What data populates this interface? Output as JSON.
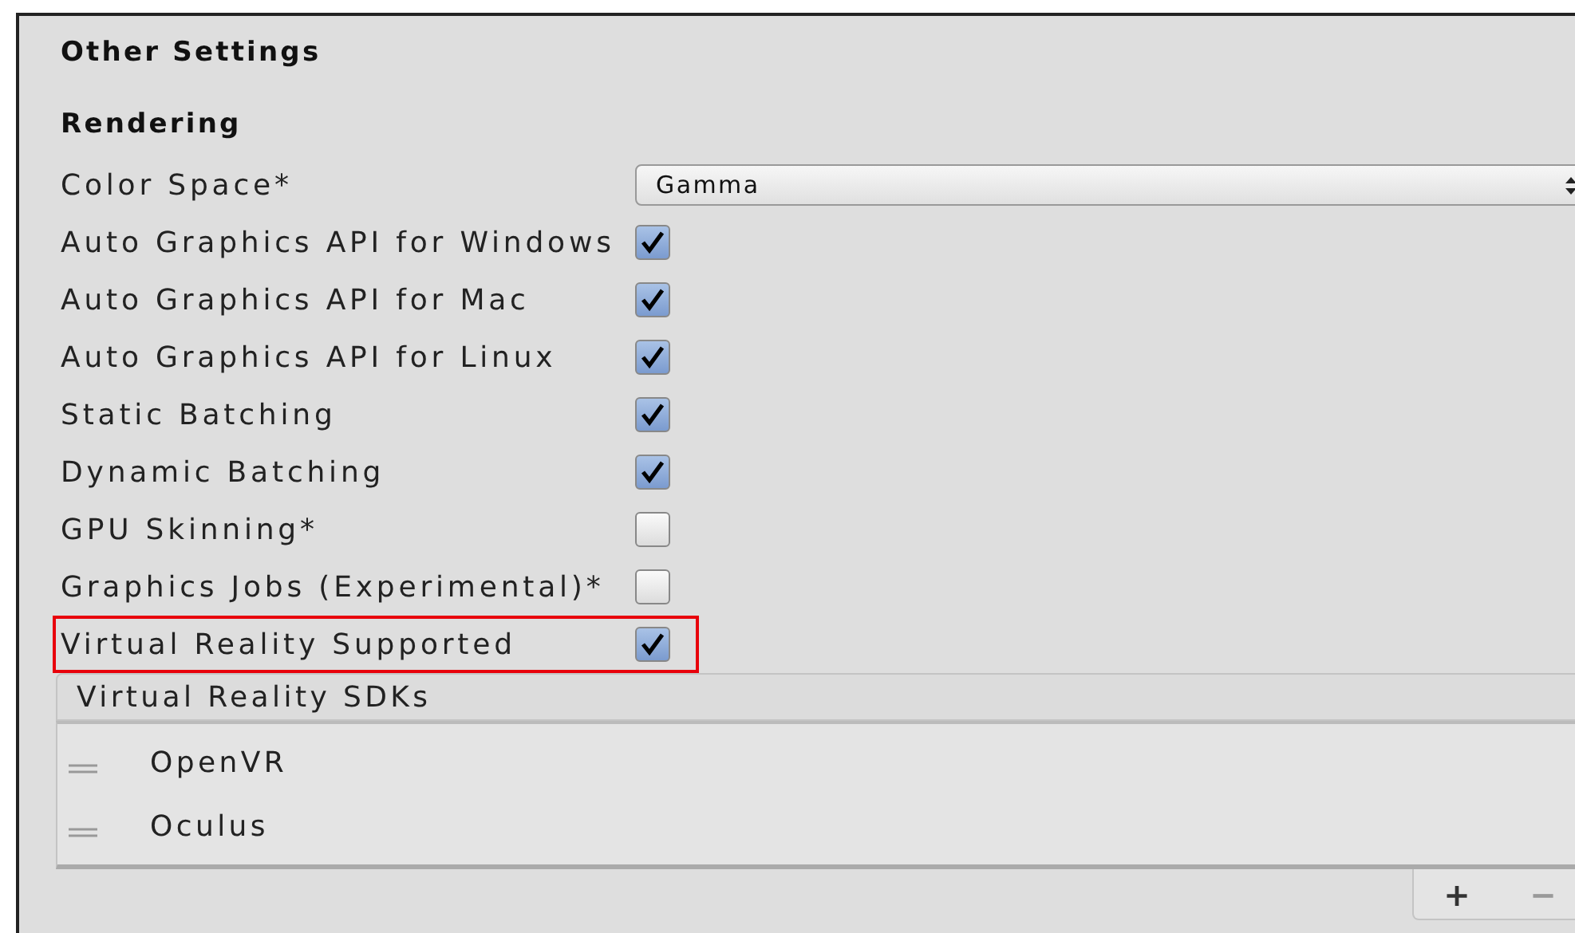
{
  "section_title": "Other Settings",
  "group_title": "Rendering",
  "color_space": {
    "label": "Color Space*",
    "value": "Gamma"
  },
  "settings": [
    {
      "label": "Auto Graphics API for Windows",
      "checked": true,
      "highlighted": false
    },
    {
      "label": "Auto Graphics API for Mac",
      "checked": true,
      "highlighted": false
    },
    {
      "label": "Auto Graphics API for Linux",
      "checked": true,
      "highlighted": false
    },
    {
      "label": "Static Batching",
      "checked": true,
      "highlighted": false
    },
    {
      "label": "Dynamic Batching",
      "checked": true,
      "highlighted": false
    },
    {
      "label": "GPU Skinning*",
      "checked": false,
      "highlighted": false
    },
    {
      "label": "Graphics Jobs (Experimental)*",
      "checked": false,
      "highlighted": false
    },
    {
      "label": "Virtual Reality Supported",
      "checked": true,
      "highlighted": true
    }
  ],
  "sdk_list": {
    "header": "Virtual Reality SDKs",
    "items": [
      "OpenVR",
      "Oculus"
    ],
    "add_label": "+",
    "remove_label": "−"
  }
}
